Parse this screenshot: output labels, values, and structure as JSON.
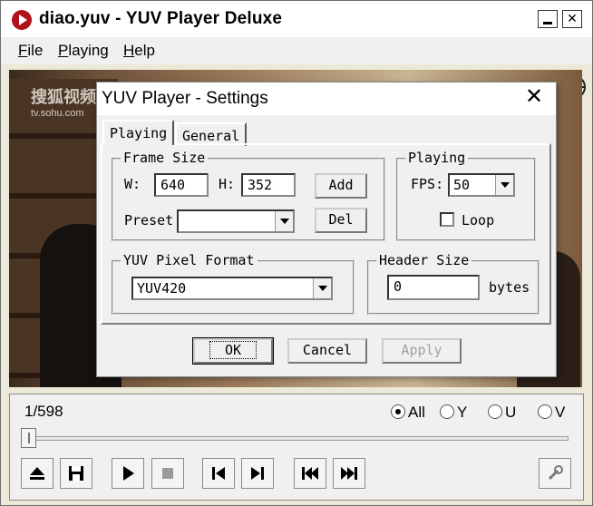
{
  "window": {
    "title": "diao.yuv - YUV Player Deluxe",
    "min_glyph": "_",
    "close_glyph": "✕"
  },
  "menu": {
    "file": "File",
    "playing": "Playing",
    "help": "Help"
  },
  "video": {
    "watermark_top": "搜狐视频",
    "watermark_bottom": "tv.sohu.com"
  },
  "controls": {
    "frame_counter": "1/598",
    "channels": [
      {
        "label": "All",
        "selected": true
      },
      {
        "label": "Y",
        "selected": false
      },
      {
        "label": "U",
        "selected": false
      },
      {
        "label": "V",
        "selected": false
      }
    ],
    "position_fraction": 0.0
  },
  "dialog": {
    "title": "YUV Player - Settings",
    "close_glyph": "✕",
    "tabs": [
      "Playing",
      "General"
    ],
    "active_tab": "Playing",
    "frame_size": {
      "label": "Frame Size",
      "w_label": "W:",
      "w_value": "640",
      "h_label": "H:",
      "h_value": "352",
      "add": "Add",
      "preset_label": "Preset",
      "preset_value": "",
      "del": "Del"
    },
    "playing": {
      "label": "Playing",
      "fps_label": "FPS:",
      "fps_value": "50",
      "loop_label": "Loop",
      "loop_checked": false
    },
    "pixel_format": {
      "label": "YUV Pixel Format",
      "value": "YUV420"
    },
    "header_size": {
      "label": "Header Size",
      "value": "0",
      "unit": "bytes"
    },
    "buttons": {
      "ok": "OK",
      "cancel": "Cancel",
      "apply": "Apply"
    }
  }
}
